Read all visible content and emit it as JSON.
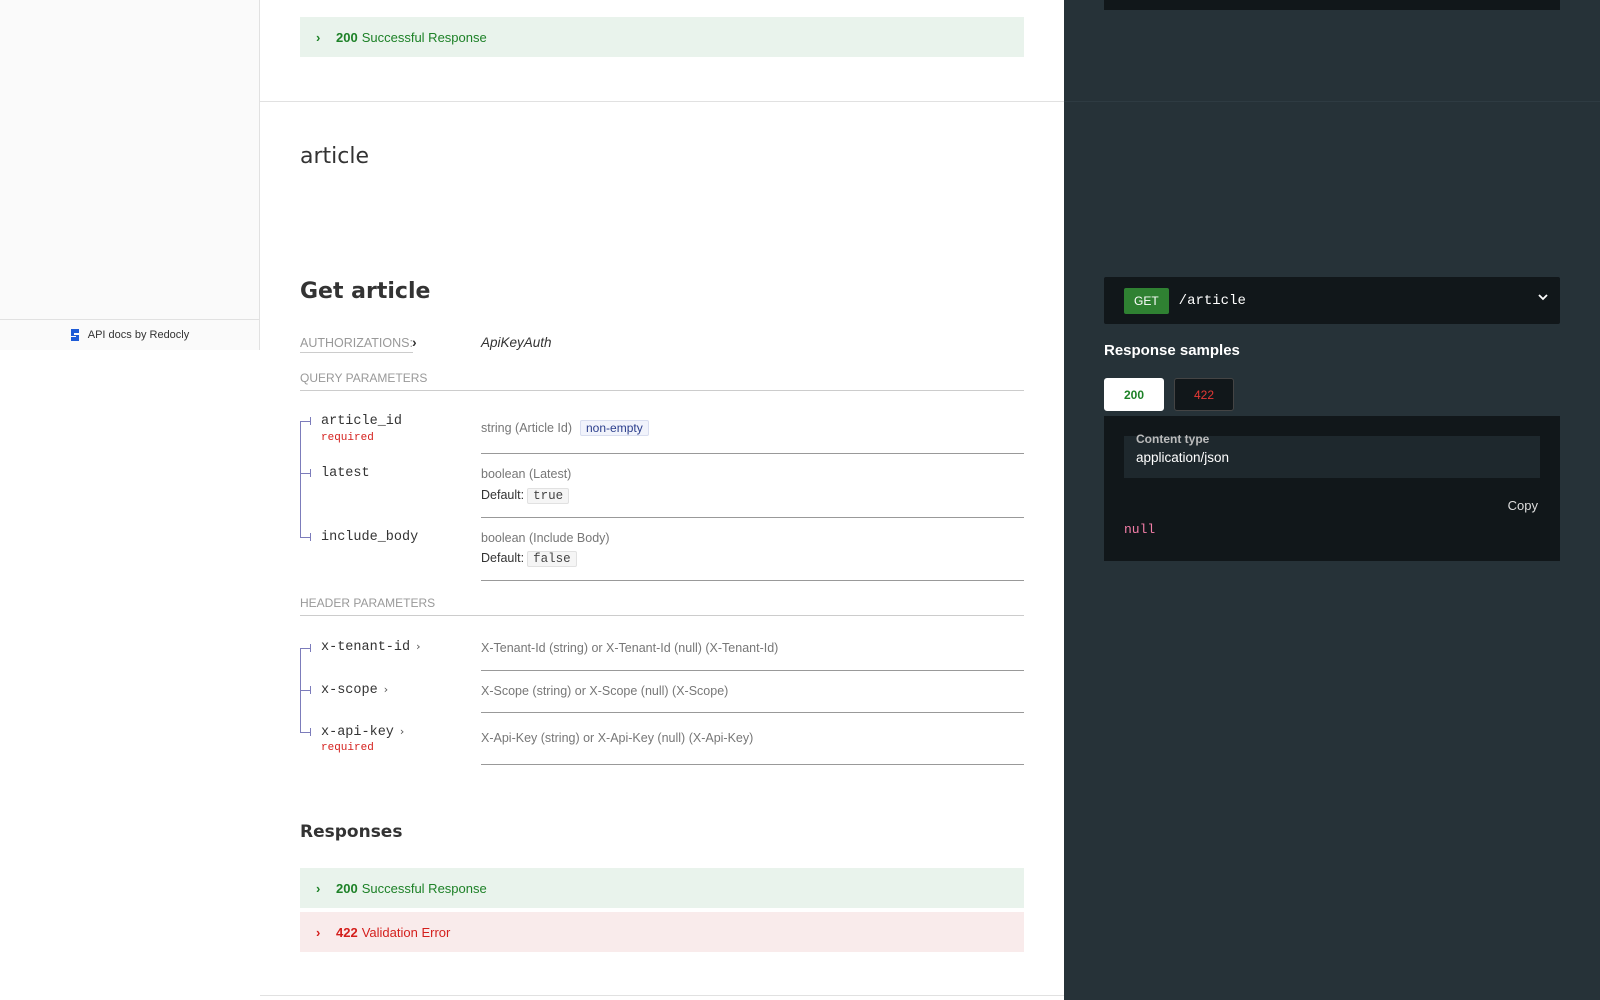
{
  "sidebar": {
    "powered_by": "API docs by Redocly"
  },
  "top_response": {
    "code": "200",
    "label": "Successful Response"
  },
  "tag": {
    "title": "article"
  },
  "operation": {
    "title": "Get article",
    "authorizations_label": "Authorizations:",
    "auth_scheme": "ApiKeyAuth",
    "query_section_title": "Query Parameters",
    "query_params": [
      {
        "name": "article_id",
        "required": "required",
        "type": "string (Article Id)",
        "badge": "non-empty"
      },
      {
        "name": "latest",
        "type": "boolean (Latest)",
        "default_label": "Default:",
        "default": "true"
      },
      {
        "name": "include_body",
        "type": "boolean (Include Body)",
        "default_label": "Default:",
        "default": "false"
      }
    ],
    "header_section_title": "Header Parameters",
    "header_params": [
      {
        "name": "x-tenant-id",
        "type": "X-Tenant-Id (string) or X-Tenant-Id (null) (X-Tenant-Id)"
      },
      {
        "name": "x-scope",
        "type": "X-Scope (string) or X-Scope (null) (X-Scope)"
      },
      {
        "name": "x-api-key",
        "required": "required",
        "type": "X-Api-Key (string) or X-Api-Key (null) (X-Api-Key)"
      }
    ],
    "responses_title": "Responses",
    "responses": [
      {
        "code": "200",
        "label": "Successful Response"
      },
      {
        "code": "422",
        "label": "Validation Error"
      }
    ]
  },
  "right_panel": {
    "method": "GET",
    "path": "/article",
    "samples_title": "Response samples",
    "tabs": [
      "200",
      "422"
    ],
    "content_type_label": "Content type",
    "content_type": "application/json",
    "copy_label": "Copy",
    "sample_value": "null"
  },
  "colors": {
    "success": "#1d8127",
    "error": "#d41f1c",
    "dark_panel": "#263238",
    "code_bg": "#11171a",
    "get_method": "#2f8132"
  }
}
